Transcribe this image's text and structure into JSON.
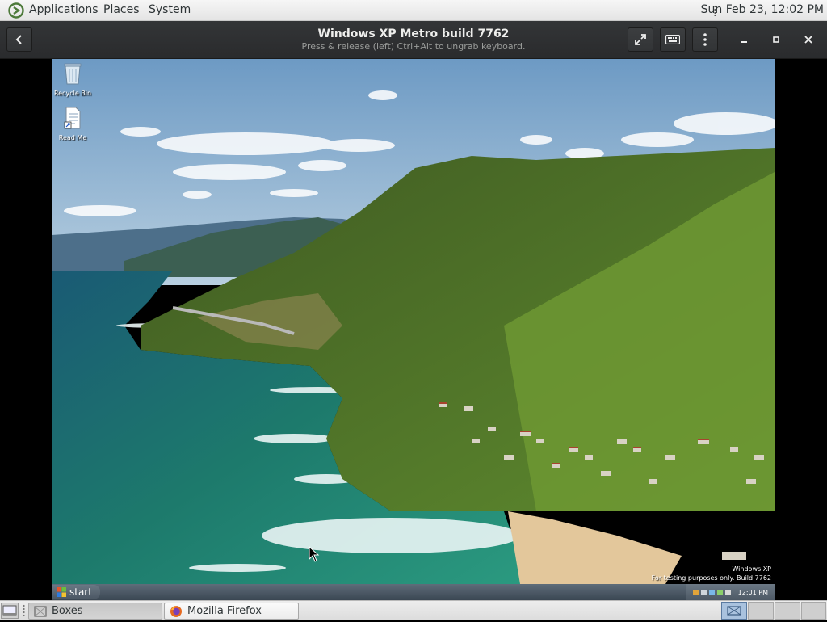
{
  "top_panel": {
    "menus": [
      "Applications",
      "Places",
      "System"
    ],
    "clock": "Sun Feb 23, 12:02 PM"
  },
  "headerbar": {
    "title": "Windows XP Metro build 7762",
    "subtitle": "Press & release (left) Ctrl+Alt to ungrab keyboard.",
    "buttons": [
      "back-icon",
      "fullscreen-icon",
      "keyboard-icon",
      "menu-icon",
      "minimize-icon",
      "maximize-icon",
      "close-icon"
    ]
  },
  "vm": {
    "desktop_icons": [
      {
        "label": "Recycle Bin",
        "icon": "recycle-bin-icon"
      },
      {
        "label": "Read Me",
        "icon": "document-shortcut-icon"
      }
    ],
    "watermark": {
      "line1": "Windows XP",
      "line2": "For testing purposes only. Build 7762"
    },
    "taskbar": {
      "start_label": "start",
      "tray_time": "12:01 PM"
    }
  },
  "bottom_panel": {
    "tasks": [
      {
        "label": "Boxes",
        "icon": "boxes-icon",
        "active": true
      },
      {
        "label": "Mozilla Firefox",
        "icon": "firefox-icon",
        "active": false
      }
    ]
  },
  "colors": {
    "panel_bg": "#e8e8e8",
    "headerbar_bg": "#2e3032",
    "sky": "#7fa7c9",
    "sea": "#1f7a6e",
    "hills": "#4a6b2a"
  }
}
